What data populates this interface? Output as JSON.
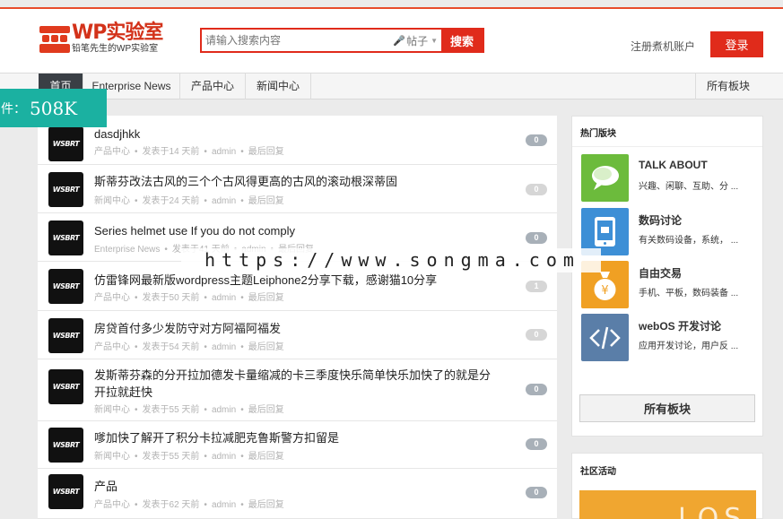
{
  "header": {
    "logo_title": "WP实验室",
    "logo_subtitle": "铅笔先生的WP实验室",
    "search_placeholder": "请输入搜索内容",
    "search_scope": "帖子",
    "search_button": "搜索",
    "register": "注册煮机账户",
    "login": "登录"
  },
  "nav": {
    "items": [
      {
        "label": "首页"
      },
      {
        "label": "Enterprise News"
      },
      {
        "label": "产品中心"
      },
      {
        "label": "新闻中心"
      }
    ],
    "all_forums": "所有板块"
  },
  "size_badge": {
    "label": "件：",
    "value": "508K"
  },
  "watermark": "https://www.songma.com",
  "avatar_text": "WSBRT",
  "posts": [
    {
      "title": "dasdjhkk",
      "category": "产品中心",
      "posted": "发表于14 天前",
      "author": "admin",
      "last_reply": "最后回复",
      "count": "0"
    },
    {
      "title": "斯蒂芬改法古风的三个个古风得更高的古风的滚动根深蒂固",
      "category": "新闻中心",
      "posted": "发表于24 天前",
      "author": "admin",
      "last_reply": "最后回复",
      "count": "0"
    },
    {
      "title": "Series helmet use If you do not comply",
      "category": "Enterprise News",
      "posted": "发表于41 天前",
      "author": "admin",
      "last_reply": "最后回复",
      "count": "0"
    },
    {
      "title": "仿雷锋网最新版wordpress主题Leiphone2分享下载，感谢猫10分享",
      "category": "产品中心",
      "posted": "发表于50 天前",
      "author": "admin",
      "last_reply": "最后回复",
      "count": "1"
    },
    {
      "title": "房贷首付多少发防守对方阿福阿福发",
      "category": "产品中心",
      "posted": "发表于54 天前",
      "author": "admin",
      "last_reply": "最后回复",
      "count": "0"
    },
    {
      "title": "发斯蒂芬森的分开拉加德发卡量缩减的卡三季度快乐简单快乐加快了的就是分开拉就赶快",
      "category": "新闻中心",
      "posted": "发表于55 天前",
      "author": "admin",
      "last_reply": "最后回复",
      "count": "0"
    },
    {
      "title": "嗲加快了解开了积分卡拉减肥克鲁斯警方扣留是",
      "category": "新闻中心",
      "posted": "发表于55 天前",
      "author": "admin",
      "last_reply": "最后回复",
      "count": "0"
    },
    {
      "title": "产品",
      "category": "产品中心",
      "posted": "发表于62 天前",
      "author": "admin",
      "last_reply": "最后回复",
      "count": "0"
    }
  ],
  "sidebar": {
    "hot_title": "热门版块",
    "forums": [
      {
        "name": "TALK ABOUT",
        "desc": "兴趣、闲聊、互助、分 ...",
        "color": "#6cbb3c",
        "icon": "chat-bubble-icon"
      },
      {
        "name": "数码讨论",
        "desc": "有关数码设备，系统，  ...",
        "color": "#3d8fd6",
        "icon": "tablet-icon"
      },
      {
        "name": "自由交易",
        "desc": "手机、平板，数码装备 ...",
        "color": "#f0a023",
        "icon": "money-bag-icon"
      },
      {
        "name": "webOS 开发讨论",
        "desc": "应用开发讨论，用户反 ...",
        "color": "#5a7ea8",
        "icon": "code-icon"
      }
    ],
    "all_forums_button": "所有板块",
    "activity_title": "社区活动",
    "promo_text": "LOS"
  },
  "colors": {
    "accent": "#e02b1b",
    "nav_active": "#3a3f45",
    "badge": "#1bb1a1"
  }
}
